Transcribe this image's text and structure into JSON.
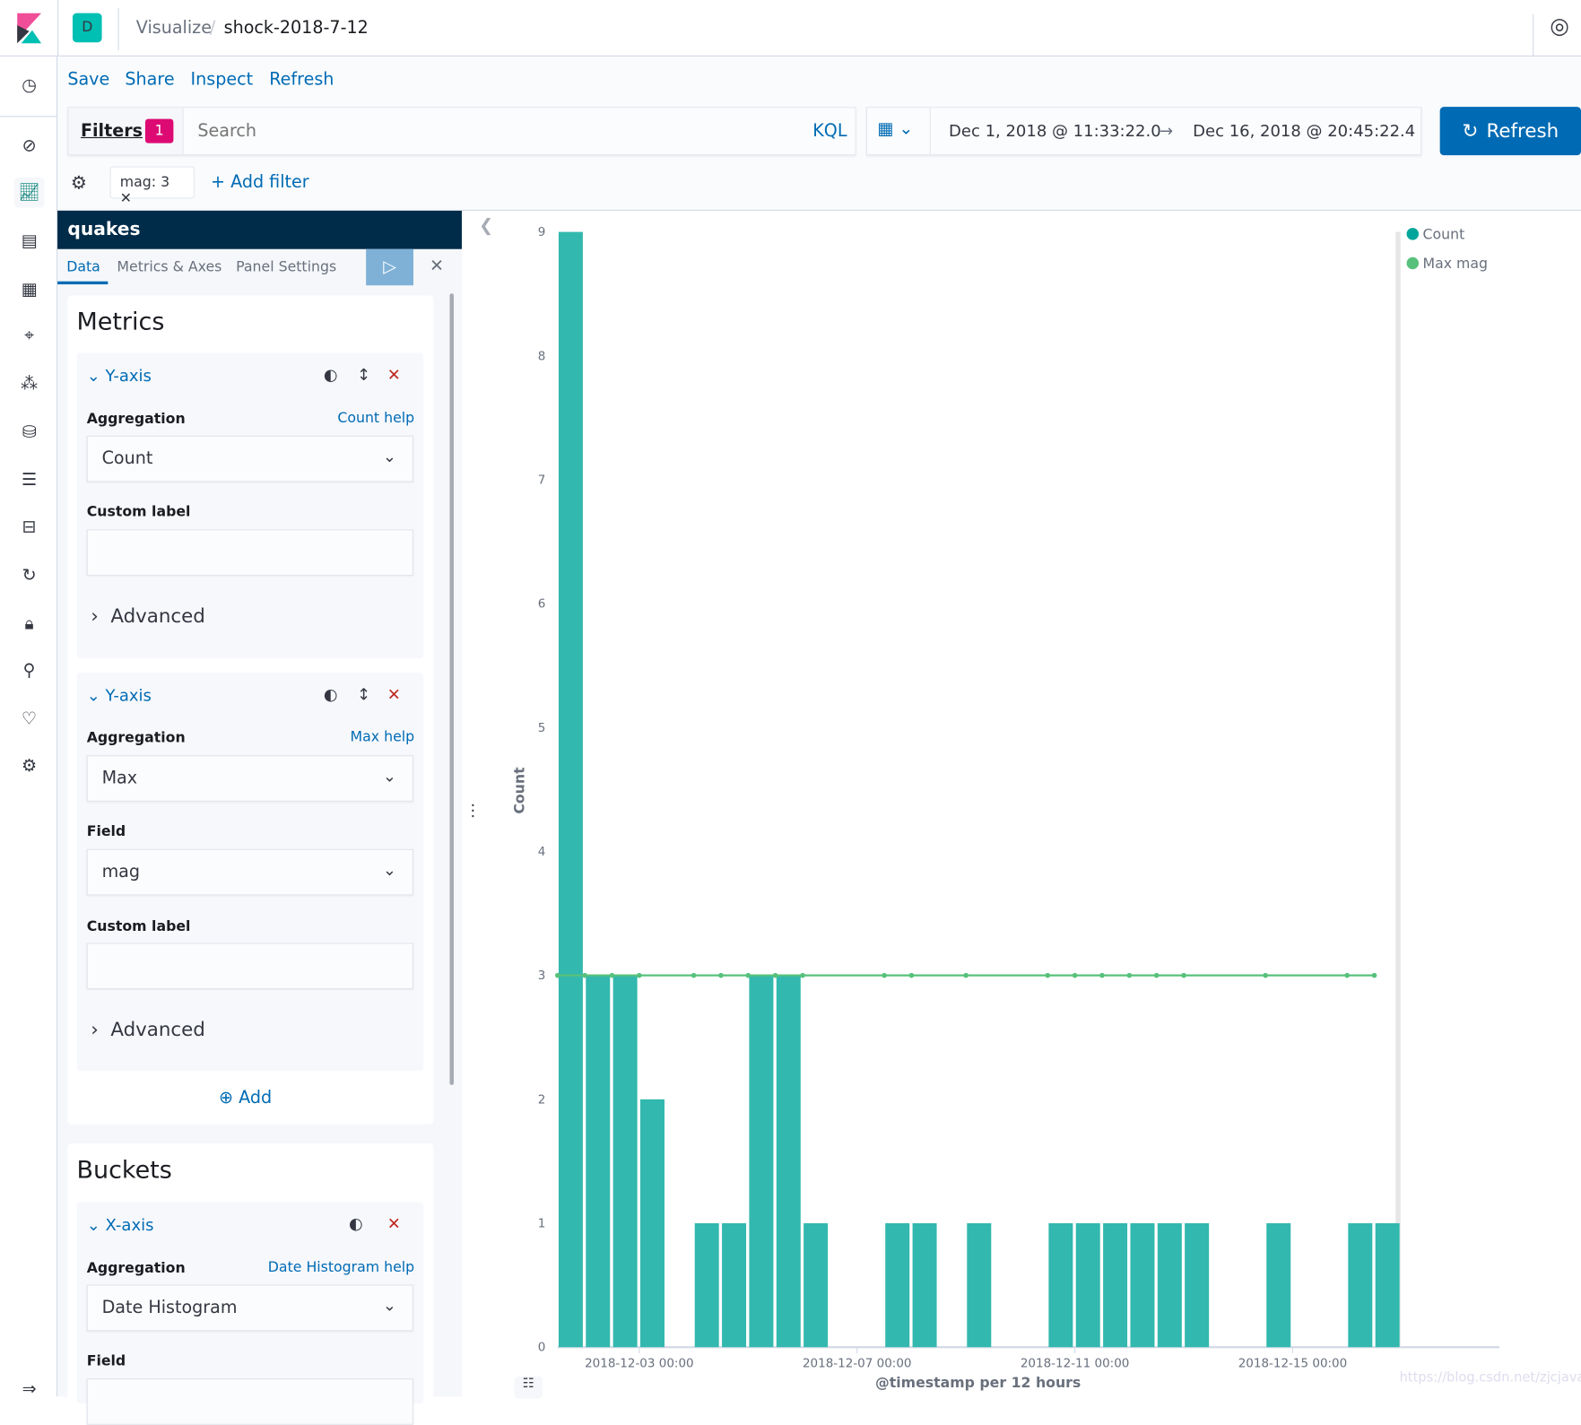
{
  "header": {
    "app_badge": "D",
    "breadcrumb_parent": "Visualize",
    "breadcrumb_current": "shock-2018-7-12"
  },
  "toolbar": {
    "save": "Save",
    "share": "Share",
    "inspect": "Inspect",
    "refresh": "Refresh"
  },
  "query": {
    "filters_label": "Filters",
    "filters_count": "1",
    "search_placeholder": "Search",
    "kql": "KQL",
    "date_start": "Dec 1, 2018 @ 11:33:22.0",
    "date_arrow": "→",
    "date_end": "Dec 16, 2018 @ 20:45:22.4",
    "refresh_button": "Refresh"
  },
  "filters": {
    "pill": "mag: 3",
    "add_filter": "+ Add filter"
  },
  "editor": {
    "index_pattern": "quakes",
    "tabs": [
      "Data",
      "Metrics & Axes",
      "Panel Settings"
    ],
    "metrics_title": "Metrics",
    "metric1": {
      "title": "Y-axis",
      "aggregation_label": "Aggregation",
      "help": "Count help",
      "aggregation": "Count",
      "custom_label": "Custom label",
      "custom_label_value": "",
      "advanced": "Advanced"
    },
    "metric2": {
      "title": "Y-axis",
      "aggregation_label": "Aggregation",
      "help": "Max help",
      "aggregation": "Max",
      "field_label": "Field",
      "field": "mag",
      "custom_label": "Custom label",
      "custom_label_value": "",
      "advanced": "Advanced"
    },
    "add": "Add",
    "buckets_title": "Buckets",
    "bucket1": {
      "title": "X-axis",
      "aggregation_label": "Aggregation",
      "help": "Date Histogram help",
      "aggregation": "Date Histogram",
      "field_label": "Field"
    }
  },
  "watermark": "https://blog.csdn.net/zjcjava",
  "chart_data": {
    "type": "bar+line",
    "xlabel": "@timestamp per 12 hours",
    "ylabel": "Count",
    "ylim": [
      0,
      9
    ],
    "yticks": [
      "0",
      "1",
      "2",
      "3",
      "4",
      "5",
      "6",
      "7",
      "8",
      "9"
    ],
    "xticks": [
      "2018-12-03 00:00",
      "2018-12-07 00:00",
      "2018-12-11 00:00",
      "2018-12-15 00:00"
    ],
    "legend": {
      "placement": "right",
      "entries": [
        {
          "name": "Count",
          "color": "#00a69b"
        },
        {
          "name": "Max mag",
          "color": "#57c17b"
        }
      ]
    },
    "bar_color": "#32b8ae",
    "line_color": "#57c17b",
    "buckets": [
      {
        "x": "2018-12-01 12:00",
        "count": 9,
        "max_mag": 3
      },
      {
        "x": "2018-12-02 00:00",
        "count": 3,
        "max_mag": 3
      },
      {
        "x": "2018-12-02 12:00",
        "count": 3,
        "max_mag": 3
      },
      {
        "x": "2018-12-03 00:00",
        "count": 2,
        "max_mag": 3
      },
      {
        "x": "2018-12-04 00:00",
        "count": 1,
        "max_mag": 3
      },
      {
        "x": "2018-12-04 12:00",
        "count": 1,
        "max_mag": 3
      },
      {
        "x": "2018-12-05 00:00",
        "count": 3,
        "max_mag": 3
      },
      {
        "x": "2018-12-05 12:00",
        "count": 3,
        "max_mag": 3
      },
      {
        "x": "2018-12-06 00:00",
        "count": 1,
        "max_mag": 3
      },
      {
        "x": "2018-12-07 12:00",
        "count": 1,
        "max_mag": 3
      },
      {
        "x": "2018-12-08 00:00",
        "count": 1,
        "max_mag": 3
      },
      {
        "x": "2018-12-09 00:00",
        "count": 1,
        "max_mag": 3
      },
      {
        "x": "2018-12-10 12:00",
        "count": 1,
        "max_mag": 3
      },
      {
        "x": "2018-12-11 00:00",
        "count": 1,
        "max_mag": 3
      },
      {
        "x": "2018-12-11 12:00",
        "count": 1,
        "max_mag": 3
      },
      {
        "x": "2018-12-12 00:00",
        "count": 1,
        "max_mag": 3
      },
      {
        "x": "2018-12-12 12:00",
        "count": 1,
        "max_mag": 3
      },
      {
        "x": "2018-12-13 00:00",
        "count": 1,
        "max_mag": 3
      },
      {
        "x": "2018-12-14 12:00",
        "count": 1,
        "max_mag": 3
      },
      {
        "x": "2018-12-16 00:00",
        "count": 1,
        "max_mag": 3
      },
      {
        "x": "2018-12-16 12:00",
        "count": 1,
        "max_mag": 3
      }
    ]
  }
}
